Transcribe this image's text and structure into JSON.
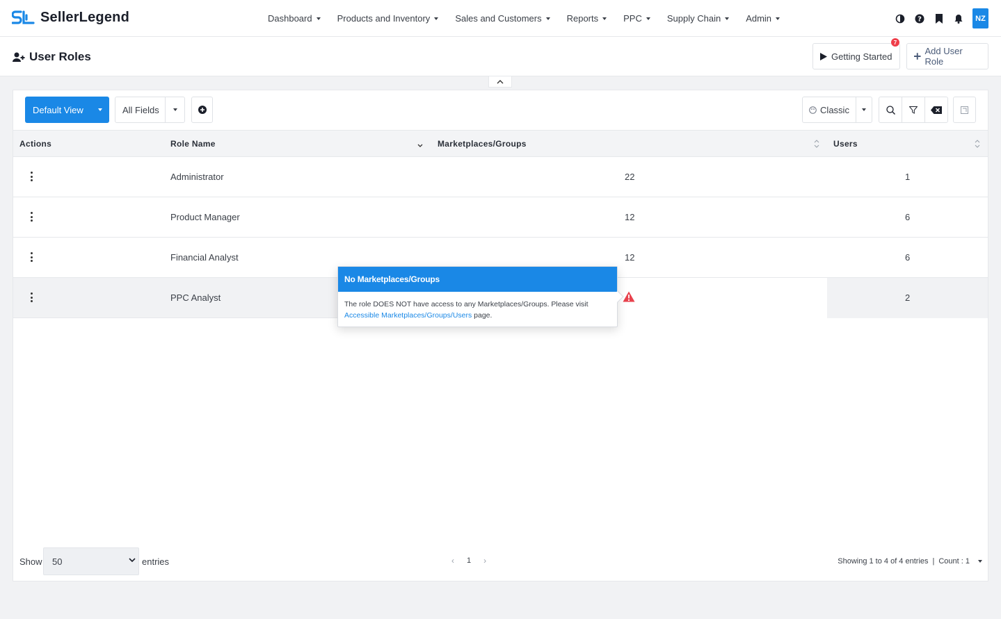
{
  "app": {
    "brand": "SellerLegend",
    "brand_color": "#1a88e6"
  },
  "nav": {
    "items": [
      {
        "label": "Dashboard"
      },
      {
        "label": "Products and Inventory"
      },
      {
        "label": "Sales and Customers"
      },
      {
        "label": "Reports"
      },
      {
        "label": "PPC"
      },
      {
        "label": "Supply Chain"
      },
      {
        "label": "Admin"
      }
    ],
    "icons": [
      "contrast-icon",
      "help-icon",
      "bookmark-icon",
      "bell-icon"
    ],
    "avatar_initials": "NZ"
  },
  "header": {
    "title": "User Roles",
    "getting_started_label": "Getting Started",
    "getting_started_badge": "7",
    "add_role_label": "Add User Role"
  },
  "toolbar": {
    "view_label": "Default View",
    "fields_label": "All Fields",
    "layout_label": "Classic"
  },
  "table": {
    "columns": [
      "Actions",
      "Role Name",
      "Marketplaces/Groups",
      "Users"
    ],
    "rows": [
      {
        "role": "Administrator",
        "marketplaces": "22",
        "users": "1"
      },
      {
        "role": "Product Manager",
        "marketplaces": "12",
        "users": "6"
      },
      {
        "role": "Financial Analyst",
        "marketplaces": "12",
        "users": "6"
      },
      {
        "role": "PPC Analyst",
        "marketplaces": "",
        "users": "2",
        "warning_icon": "warning-triangle-icon"
      }
    ]
  },
  "popover": {
    "title": "No Marketplaces/Groups",
    "body_before": "The role DOES NOT have access to any Marketplaces/Groups. Please visit",
    "link": "Accessible Marketplaces/Groups/Users",
    "body_after": "page."
  },
  "footer": {
    "show_label": "Show",
    "entries_value": "50",
    "entries_label": "entries",
    "page": "1",
    "showing_text": "Showing 1 to 4 of 4 entries",
    "count_text": "Count : 1"
  }
}
